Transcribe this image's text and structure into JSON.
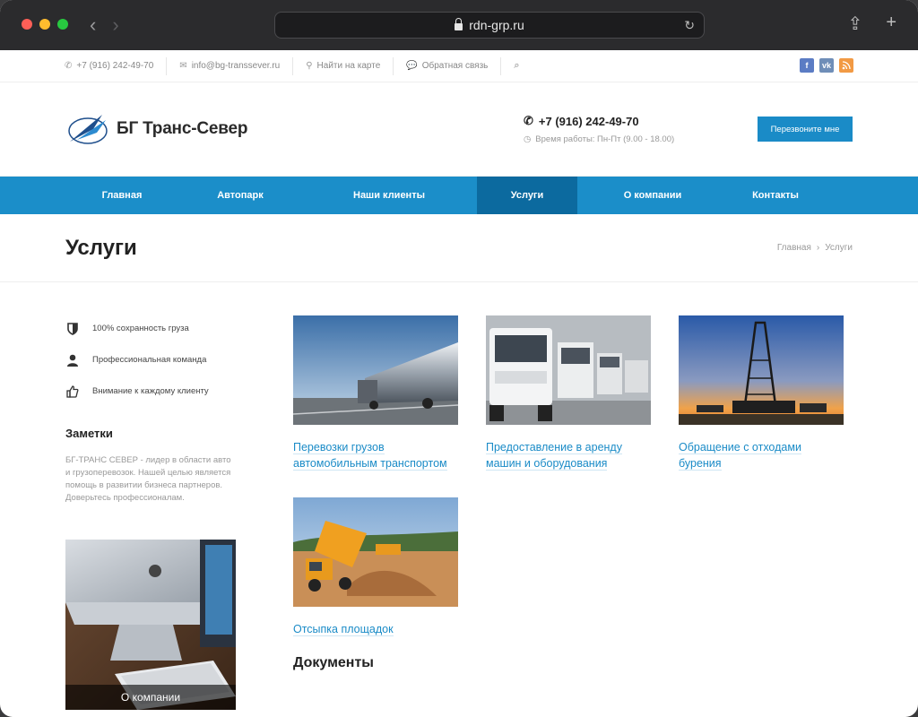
{
  "browser": {
    "url": "rdn-grp.ru"
  },
  "topbar": {
    "phone": "+7 (916) 242-49-70",
    "email": "info@bg-transsever.ru",
    "map": "Найти на карте",
    "feedback": "Обратная связь",
    "social": {
      "fb": "f",
      "vk": "vk",
      "rss": "rss"
    }
  },
  "header": {
    "logo_text": "БГ Транс-Север",
    "phone": "+7 (916) 242-49-70",
    "hours": "Время работы: Пн-Пт (9.00 - 18.00)",
    "callback_label": "Перезвоните мне"
  },
  "nav": [
    "Главная",
    "Автопарк",
    "Наши клиенты",
    "Услуги",
    "О компании",
    "Контакты"
  ],
  "page": {
    "title": "Услуги",
    "breadcrumb_home": "Главная",
    "breadcrumb_sep": "›",
    "breadcrumb_current": "Услуги"
  },
  "sidebar": {
    "features": [
      "100% сохранность груза",
      "Профессиональная команда",
      "Внимание к каждому клиенту"
    ],
    "notes_title": "Заметки",
    "notes_text": "БГ-ТРАНС СЕВЕР - лидер в области авто и грузоперевозок. Нашей целью является помощь в развитии бизнеса партнеров. Доверьтесь профессионалам.",
    "promo_caption": "О компании"
  },
  "services": [
    "Перевозки грузов автомобильным транспортом",
    "Предоставление в аренду машин и оборудования",
    "Обращение с отходами бурения",
    "Отсыпка площадок"
  ],
  "documents_title": "Документы"
}
